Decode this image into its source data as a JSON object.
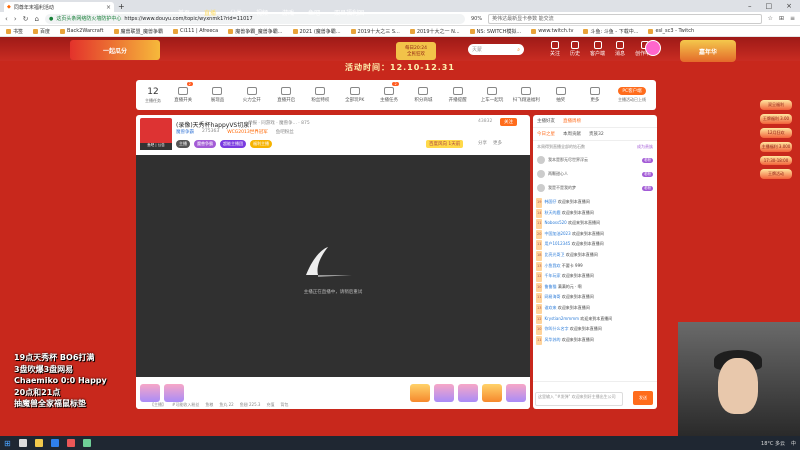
{
  "browser": {
    "tab_title": "同尊年末福利活动",
    "url": "https://www.douyu.com/topic/wyxnmk1?rid=11017",
    "url_hint": "这页头条网络防火墙防护中心",
    "zoom": "90%",
    "search_placeholder": "英伟达最新显卡参数 能交流",
    "bookmarks": [
      "书签",
      "百度",
      "Back2Warcraft",
      "魔兽联盟_魔兽争霸",
      "Ci111 | Afreeca",
      "魔兽争霸_魔兽争霸...",
      "2021 (魔兽争霸...",
      "2019十大之三 S...",
      "2019十大之一 N...",
      "NS: SWITCH模拟...",
      "www.twitch.tv",
      "斗鱼: 斗鱼 - 下载中...",
      "esl_sc3 - Twitch"
    ]
  },
  "site": {
    "nav": [
      "首页",
      "直播",
      "分类",
      "视频",
      "游戏",
      "鱼吧",
      "双旦福利回"
    ],
    "event_pill_top": "每日20:24",
    "event_pill_bottom": "全民狂欢",
    "search_placeholder": "灭蒙",
    "user_icons": [
      "关注",
      "历史",
      "客户端",
      "消息",
      "创作中心"
    ],
    "gift_banner_left": "一起瓜分",
    "gift_banner_right": "嘉年华",
    "activity_time": "活动时间：12.10-12.31"
  },
  "toolbar": {
    "count": "12",
    "count_label": "主播任务",
    "items": [
      {
        "label": "直播开关",
        "badge": "2"
      },
      {
        "label": "展现品"
      },
      {
        "label": "火力全开"
      },
      {
        "label": "直播开启"
      },
      {
        "label": "粉丝特权"
      },
      {
        "label": "全部玩PK"
      },
      {
        "label": "主播任务",
        "badge": "2"
      },
      {
        "label": "积分商城"
      },
      {
        "label": "开播提醒"
      },
      {
        "label": "上车一起玩"
      },
      {
        "label": "扫飞翔送福利"
      },
      {
        "label": "抽奖"
      },
      {
        "label": "更多"
      }
    ],
    "pc_label": "PC客户端",
    "pc_sub": "主播活动已上线"
  },
  "room": {
    "streamer_tag": "鱼吧 | 公告",
    "title": "(录像)天秀杯happyVS切泉!",
    "meta": "举报 · 同游戏 · 魔兽争... · 875",
    "report": "43832",
    "follow": "关注",
    "category": "魔兽争霸",
    "heat": "275363",
    "group": "WCG2013世界冠军",
    "extra": "鱼吧粉丝",
    "tags": [
      "主播",
      "魔兽争霸",
      "超能主播团",
      "福利主播"
    ],
    "rank": "百度风向 1天前",
    "share": "分享",
    "more": "更多",
    "loading_text": "主播正在直播中，请稍后重试",
    "chat_info": [
      "【主播】",
      "#可能收入粉丝"
    ],
    "bottom_status": [
      "鱼粮",
      "鱼丸 22",
      "鱼翅 225.3",
      "充值",
      "背包"
    ]
  },
  "sidebar": {
    "tabs": [
      "主播好友",
      "直播周榜"
    ],
    "subtabs": [
      "今日之星",
      "本周贡献",
      "贵族32"
    ],
    "rank_head": "本周得到直播全部的钻石数",
    "rank_btn": "成为贵族",
    "fans": [
      {
        "name": "我本是那无尽世界浮云",
        "badge": "老粉"
      },
      {
        "name": "两颗甜心人",
        "badge": "老粉"
      },
      {
        "name": "我是不是我的梦",
        "badge": "老粉"
      }
    ],
    "messages": [
      {
        "lv": "19",
        "user": "韩国仔",
        "text": "欢迎来到本直播间"
      },
      {
        "lv": "14",
        "user": "秋天的鹿",
        "text": "欢迎来到本直播间"
      },
      {
        "lv": "11",
        "user": "Noboss520",
        "text": "欢迎来到本直播间"
      },
      {
        "lv": "20",
        "user": "中国加油2023",
        "text": "欢迎来到本直播间"
      },
      {
        "lv": "11",
        "user": "用户1012345",
        "text": "欢迎来到本直播间"
      },
      {
        "lv": "18",
        "user": "比亮光哥卫",
        "text": "欢迎来到本直播间"
      },
      {
        "lv": "13",
        "user": "小鱼我欢",
        "text": "不要卡 999"
      },
      {
        "lv": "12",
        "user": "千年玩家",
        "text": "欢迎来到本直播间"
      },
      {
        "lv": "10",
        "user": "鲁鲁猫",
        "text": "满满的元 · 啊"
      },
      {
        "lv": "11",
        "user": "网易海哥",
        "text": "欢迎来到本直播间"
      },
      {
        "lv": "13",
        "user": "谁欢来",
        "text": "欢迎来到本直播间"
      },
      {
        "lv": "12",
        "user": "Krystian2mmmm",
        "text": "欢迎来到本直播间"
      },
      {
        "lv": "10",
        "user": "你叫什么名字",
        "text": "欢迎来到本直播间"
      },
      {
        "lv": "11",
        "user": "风华苏的",
        "text": "欢迎来到本直播间"
      }
    ],
    "input_placeholder": "这里输入 \"#发弹\" 欢迎来到好主播出生公司",
    "send": "发送"
  },
  "right_ad": [
    "双旦福利",
    "王牌福利 3.00",
    "12月狂欢",
    "主播福利 3.000",
    "17:30-18:00",
    "王牌活动"
  ],
  "overlay": [
    "19点天秀杯 BO6打满",
    "3盘吹爆3盘网易",
    "Chaemiko 0:0 Happy",
    "20点和21点",
    "抽魔兽全家福鼠标垫"
  ],
  "taskbar": {
    "weather": "18°C 多云",
    "ime": "中"
  }
}
